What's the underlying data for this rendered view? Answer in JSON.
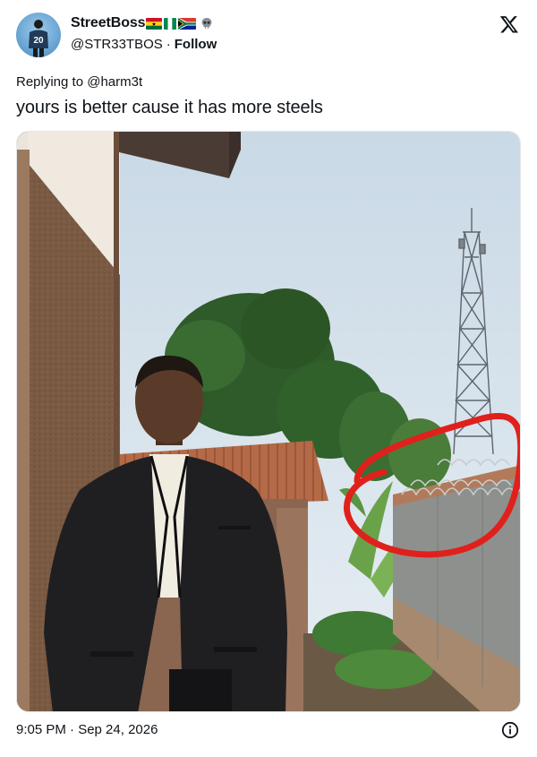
{
  "author": {
    "display_name": "StreetBoss",
    "handle": "@STR33TBOS",
    "separator": "·",
    "follow_label": "Follow",
    "badges": [
      "ghana-flag-icon",
      "nigeria-flag-icon",
      "south-africa-flag-icon",
      "skull-icon"
    ],
    "avatar_jersey": "20"
  },
  "reply": {
    "prefix": "Replying to",
    "handle": "@harm3t"
  },
  "tweet": {
    "text": "yours is better cause it has more steels"
  },
  "footer": {
    "timestamp": "9:05 PM · Sep 24, 2026"
  },
  "colors": {
    "text": "#0f1419",
    "highlight_circle": "#e0201c",
    "background": "#ffffff"
  },
  "icons": {
    "platform": "x-logo-icon",
    "info": "info-icon"
  }
}
